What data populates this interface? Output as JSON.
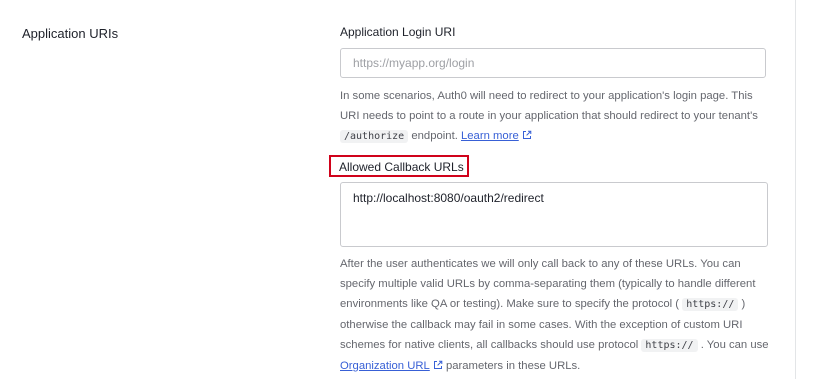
{
  "section": {
    "title": "Application URIs"
  },
  "login_uri": {
    "label": "Application Login URI",
    "placeholder": "https://myapp.org/login",
    "value": "",
    "help_text_1": "In some scenarios, Auth0 will need to redirect to your application's login page. This URI needs to point to a route in your application that should redirect to your tenant's",
    "help_code": "/authorize",
    "help_text_2": "endpoint.",
    "learn_more_link": "Learn more",
    "link_icon": "external-link-icon"
  },
  "callback_urls": {
    "label": "Allowed Callback URLs",
    "value": "http://localhost:8080/oauth2/redirect",
    "help_text_1": "After the user authenticates we will only call back to any of these URLs. You can specify multiple valid URLs by comma-separating them (typically to handle different environments like QA or testing). Make sure to specify the protocol (",
    "help_code_1": "https://",
    "help_text_2": ") otherwise the callback may fail in some cases. With the exception of custom URI schemes for native clients, all callbacks should use protocol",
    "help_code_2": "https://",
    "help_text_3": ". You can use",
    "org_url_link": "Organization URL",
    "help_text_4": "parameters in these URLs.",
    "link_icon": "external-link-icon"
  },
  "colors": {
    "highlight_border": "#d0021b",
    "link": "#3860d6",
    "text": "#1e212a",
    "help_text": "#65676e"
  }
}
